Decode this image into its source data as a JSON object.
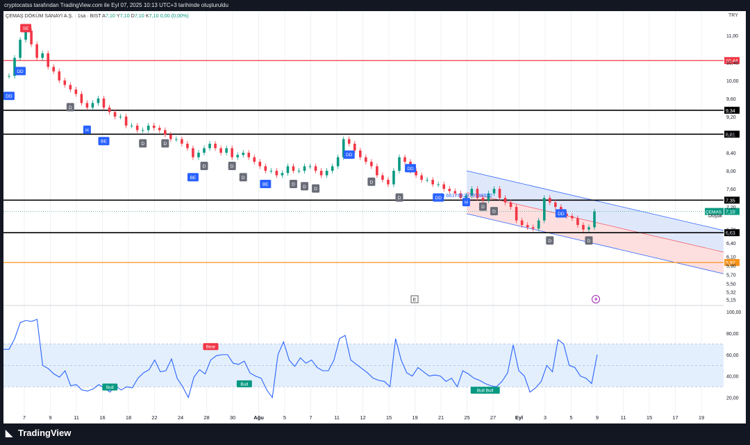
{
  "header": {
    "caption": "cryptocatss tarafından TradingView.com ile Eyl 07, 2025 10:13 UTC+3 tarihinde oluşturuldu",
    "symbol": "ÇEMAŞ DÖKÜM SANAYİ A.Ş. · 1sa · BIST",
    "ohlc": {
      "a_label": "A",
      "a": "7,10",
      "y_label": "Y",
      "y": "7,10",
      "d_label": "D",
      "d": "7,10",
      "k_label": "K",
      "k": "7,10",
      "change": "0,00 (0,00%)"
    },
    "currency": "TRY"
  },
  "footer": {
    "logo": "TradingView"
  },
  "colors": {
    "up": "#089981",
    "down": "#f23645",
    "rsi": "#2962ff",
    "channel_fill": "#dbe5fb",
    "channel_lower_fill": "#fddcdc",
    "red_line": "#f23645",
    "orange_line": "#f7931a",
    "black_line": "#000000"
  },
  "chart_data": [
    {
      "type": "line",
      "name": "price",
      "x_ticks": [
        "7",
        "9",
        "11",
        "16",
        "18",
        "22",
        "24",
        "28",
        "30",
        "Ağu",
        "5",
        "7",
        "11",
        "12",
        "15",
        "19",
        "21",
        "25",
        "27",
        "Eyl",
        "3",
        "5",
        "9",
        "11",
        "15",
        "17",
        "19"
      ],
      "y_ticks": [
        "11,00",
        "10,40",
        "10,00",
        "9,60",
        "9,20",
        "8,80",
        "8,40",
        "8,00",
        "7,60",
        "7,20",
        "6,70",
        "6,60",
        "6,40",
        "6,10",
        "5,90",
        "5,70",
        "5,50",
        "5,32",
        "5,15"
      ],
      "ylim": [
        5.05,
        11.35
      ],
      "horizontal_levels": [
        {
          "label": "10,44",
          "value": 10.44,
          "color": "#f23645"
        },
        {
          "label": "9,34",
          "value": 9.34,
          "color": "#000000"
        },
        {
          "label": "8,81",
          "value": 8.81,
          "color": "#000000"
        },
        {
          "label": "7,35",
          "value": 7.35,
          "color": "#000000"
        },
        {
          "label": "6,63",
          "value": 6.63,
          "color": "#000000"
        },
        {
          "label": "5,97",
          "value": 5.97,
          "color": "#f7931a"
        }
      ],
      "last_price": {
        "label": "ÇEMAŞ",
        "value_label": "7,10",
        "value": 7.1
      },
      "annotations": {
        "low_label": "Düşük",
        "channel_label": "0.6617652879138922",
        "earnings": "E"
      },
      "series_close": [
        10.1,
        10.5,
        10.9,
        11.1,
        10.8,
        10.5,
        10.6,
        10.3,
        10.2,
        10.0,
        9.9,
        9.8,
        9.7,
        9.5,
        9.4,
        9.5,
        9.6,
        9.4,
        9.3,
        9.2,
        9.2,
        9.0,
        9.0,
        8.9,
        8.9,
        9.0,
        8.95,
        8.9,
        8.8,
        8.7,
        8.7,
        8.6,
        8.5,
        8.3,
        8.4,
        8.5,
        8.6,
        8.5,
        8.4,
        8.5,
        8.3,
        8.35,
        8.4,
        8.3,
        8.2,
        8.1,
        8.0,
        8.0,
        7.9,
        7.95,
        8.1,
        8.0,
        8.0,
        8.1,
        8.1,
        8.0,
        7.9,
        8.0,
        8.1,
        8.3,
        8.7,
        8.6,
        8.45,
        8.3,
        8.2,
        8.1,
        7.9,
        7.8,
        7.7,
        8.0,
        8.3,
        8.2,
        8.0,
        7.9,
        7.8,
        7.8,
        7.7,
        7.7,
        7.6,
        7.55,
        7.5,
        7.4,
        7.45,
        7.6,
        7.4,
        7.35,
        7.5,
        7.6,
        7.4,
        7.3,
        7.2,
        6.9,
        6.8,
        6.75,
        6.72,
        6.9,
        7.4,
        7.3,
        7.2,
        7.05,
        7.0,
        6.95,
        6.8,
        6.7,
        6.75,
        7.1
      ],
      "labels": [
        {
          "text": "SE",
          "i": 3,
          "price": 11.25,
          "kind": "sell"
        },
        {
          "text": "DD",
          "i": 0,
          "price": 9.75,
          "kind": "blue"
        },
        {
          "text": "DD",
          "i": 2,
          "price": 10.3,
          "kind": "blue"
        },
        {
          "text": "D",
          "i": 11,
          "price": 9.5,
          "kind": "gray"
        },
        {
          "text": "H",
          "i": 14,
          "price": 9.0,
          "kind": "blue"
        },
        {
          "text": "BE",
          "i": 17,
          "price": 8.75,
          "kind": "blue"
        },
        {
          "text": "D",
          "i": 24,
          "price": 8.7,
          "kind": "gray"
        },
        {
          "text": "D",
          "i": 28,
          "price": 8.7,
          "kind": "gray"
        },
        {
          "text": "BE",
          "i": 33,
          "price": 7.95,
          "kind": "blue"
        },
        {
          "text": "D",
          "i": 35,
          "price": 8.2,
          "kind": "gray"
        },
        {
          "text": "D",
          "i": 40,
          "price": 8.2,
          "kind": "gray"
        },
        {
          "text": "D",
          "i": 42,
          "price": 7.95,
          "kind": "gray"
        },
        {
          "text": "BE",
          "i": 46,
          "price": 7.8,
          "kind": "blue"
        },
        {
          "text": "D",
          "i": 51,
          "price": 7.8,
          "kind": "gray"
        },
        {
          "text": "D",
          "i": 53,
          "price": 7.75,
          "kind": "gray"
        },
        {
          "text": "D",
          "i": 55,
          "price": 7.7,
          "kind": "gray"
        },
        {
          "text": "DD",
          "i": 61,
          "price": 8.45,
          "kind": "blue"
        },
        {
          "text": "D",
          "i": 65,
          "price": 7.85,
          "kind": "gray"
        },
        {
          "text": "D",
          "i": 70,
          "price": 7.5,
          "kind": "gray"
        },
        {
          "text": "DD",
          "i": 72,
          "price": 8.15,
          "kind": "blue"
        },
        {
          "text": "DD",
          "i": 77,
          "price": 7.5,
          "kind": "blue"
        },
        {
          "text": "H",
          "i": 82,
          "price": 7.4,
          "kind": "blue"
        },
        {
          "text": "D",
          "i": 85,
          "price": 7.3,
          "kind": "gray"
        },
        {
          "text": "D",
          "i": 87,
          "price": 7.2,
          "kind": "gray"
        },
        {
          "text": "D",
          "i": 97,
          "price": 6.55,
          "kind": "gray"
        },
        {
          "text": "DD",
          "i": 99,
          "price": 7.15,
          "kind": "blue"
        },
        {
          "text": "D",
          "i": 104,
          "price": 6.55,
          "kind": "gray"
        }
      ]
    },
    {
      "type": "line",
      "name": "rsi",
      "y_ticks": [
        "100,00",
        "80,00",
        "60,00",
        "40,00",
        "20,00"
      ],
      "ylim": [
        10,
        104
      ],
      "band": [
        30,
        70
      ],
      "mid": 50,
      "labels": [
        {
          "text": "Bear",
          "i": 37,
          "value": 63
        },
        {
          "text": "Bull",
          "i": 19,
          "value": 33
        },
        {
          "text": "Bull",
          "i": 43,
          "value": 36
        },
        {
          "text": "Bull Bull",
          "i": 86,
          "value": 30
        }
      ],
      "values": [
        65,
        65,
        75,
        90,
        92,
        91,
        93,
        50,
        47,
        42,
        39,
        45,
        31,
        32,
        27,
        26,
        28,
        32,
        29,
        25,
        31,
        27,
        30,
        29,
        38,
        43,
        46,
        55,
        44,
        45,
        56,
        38,
        30,
        20,
        39,
        46,
        42,
        55,
        59,
        60,
        60,
        52,
        51,
        54,
        43,
        40,
        38,
        27,
        20,
        60,
        72,
        55,
        49,
        57,
        52,
        55,
        48,
        45,
        45,
        55,
        75,
        78,
        55,
        51,
        47,
        43,
        38,
        36,
        35,
        30,
        75,
        55,
        43,
        40,
        48,
        44,
        40,
        41,
        40,
        35,
        38,
        30,
        45,
        42,
        38,
        36,
        33,
        31,
        30,
        35,
        43,
        69,
        45,
        40,
        25,
        29,
        35,
        50,
        44,
        74,
        70,
        50,
        48,
        40,
        38,
        33,
        60
      ]
    }
  ]
}
